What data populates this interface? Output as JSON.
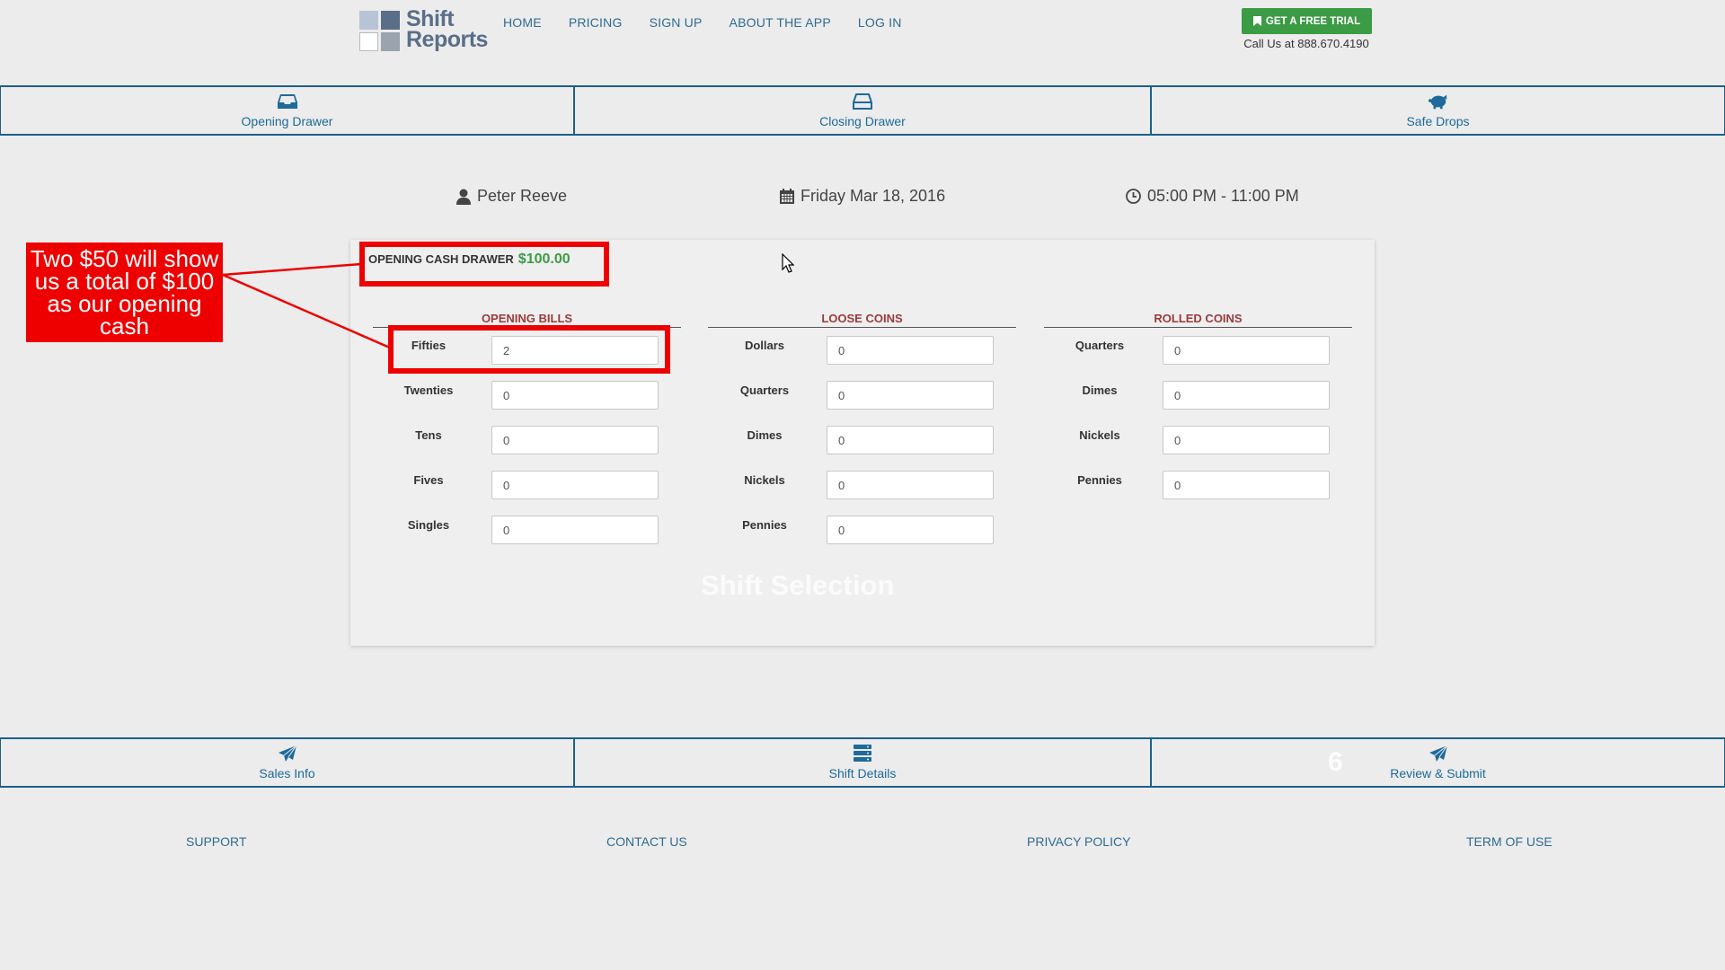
{
  "header": {
    "logo_line1": "Shift",
    "logo_line2": "Reports",
    "nav": [
      "HOME",
      "PRICING",
      "SIGN UP",
      "ABOUT THE APP",
      "LOG IN"
    ],
    "trial_label": "GET A FREE TRIAL",
    "call_text": "Call Us at 888.670.4190"
  },
  "top_tabs": [
    {
      "label": "Opening Drawer",
      "icon": "inbox-icon"
    },
    {
      "label": "Closing Drawer",
      "icon": "drawer-icon"
    },
    {
      "label": "Safe Drops",
      "icon": "piggy-bank-icon"
    }
  ],
  "shift": {
    "employee": "Peter Reeve",
    "date": "Friday Mar 18, 2016",
    "time": "05:00 PM - 11:00 PM"
  },
  "opening_cash_drawer": {
    "label": "OPENING CASH DRAWER",
    "amount": "$100.00"
  },
  "opening_bills": {
    "heading": "OPENING BILLS",
    "rows": [
      {
        "label": "Fifties",
        "value": "2"
      },
      {
        "label": "Twenties",
        "value": "0"
      },
      {
        "label": "Tens",
        "value": "0"
      },
      {
        "label": "Fives",
        "value": "0"
      },
      {
        "label": "Singles",
        "value": "0"
      }
    ]
  },
  "loose_coins": {
    "heading": "LOOSE COINS",
    "rows": [
      {
        "label": "Dollars",
        "value": "0"
      },
      {
        "label": "Quarters",
        "value": "0"
      },
      {
        "label": "Dimes",
        "value": "0"
      },
      {
        "label": "Nickels",
        "value": "0"
      },
      {
        "label": "Pennies",
        "value": "0"
      }
    ]
  },
  "rolled_coins": {
    "heading": "ROLLED COINS",
    "rows": [
      {
        "label": "Quarters",
        "value": "0"
      },
      {
        "label": "Dimes",
        "value": "0"
      },
      {
        "label": "Nickels",
        "value": "0"
      },
      {
        "label": "Pennies",
        "value": "0"
      }
    ]
  },
  "watermark": "Shift Selection",
  "watermark_number": "6",
  "bottom_tabs": [
    {
      "label": "Sales Info",
      "icon": "paper-plane-icon"
    },
    {
      "label": "Shift Details",
      "icon": "server-icon"
    },
    {
      "label": "Review & Submit",
      "icon": "paper-plane-icon"
    }
  ],
  "annotation": {
    "text": "Two $50 will show us a total of $100 as our opening cash"
  },
  "footer": [
    "SUPPORT",
    "CONTACT US",
    "PRIVACY POLICY",
    "TERM OF USE"
  ],
  "colors": {
    "accent_blue": "#1d6a9b",
    "green": "#3c9b45",
    "heading_red": "#9b3a3a",
    "annotation_red": "#ee0000"
  }
}
